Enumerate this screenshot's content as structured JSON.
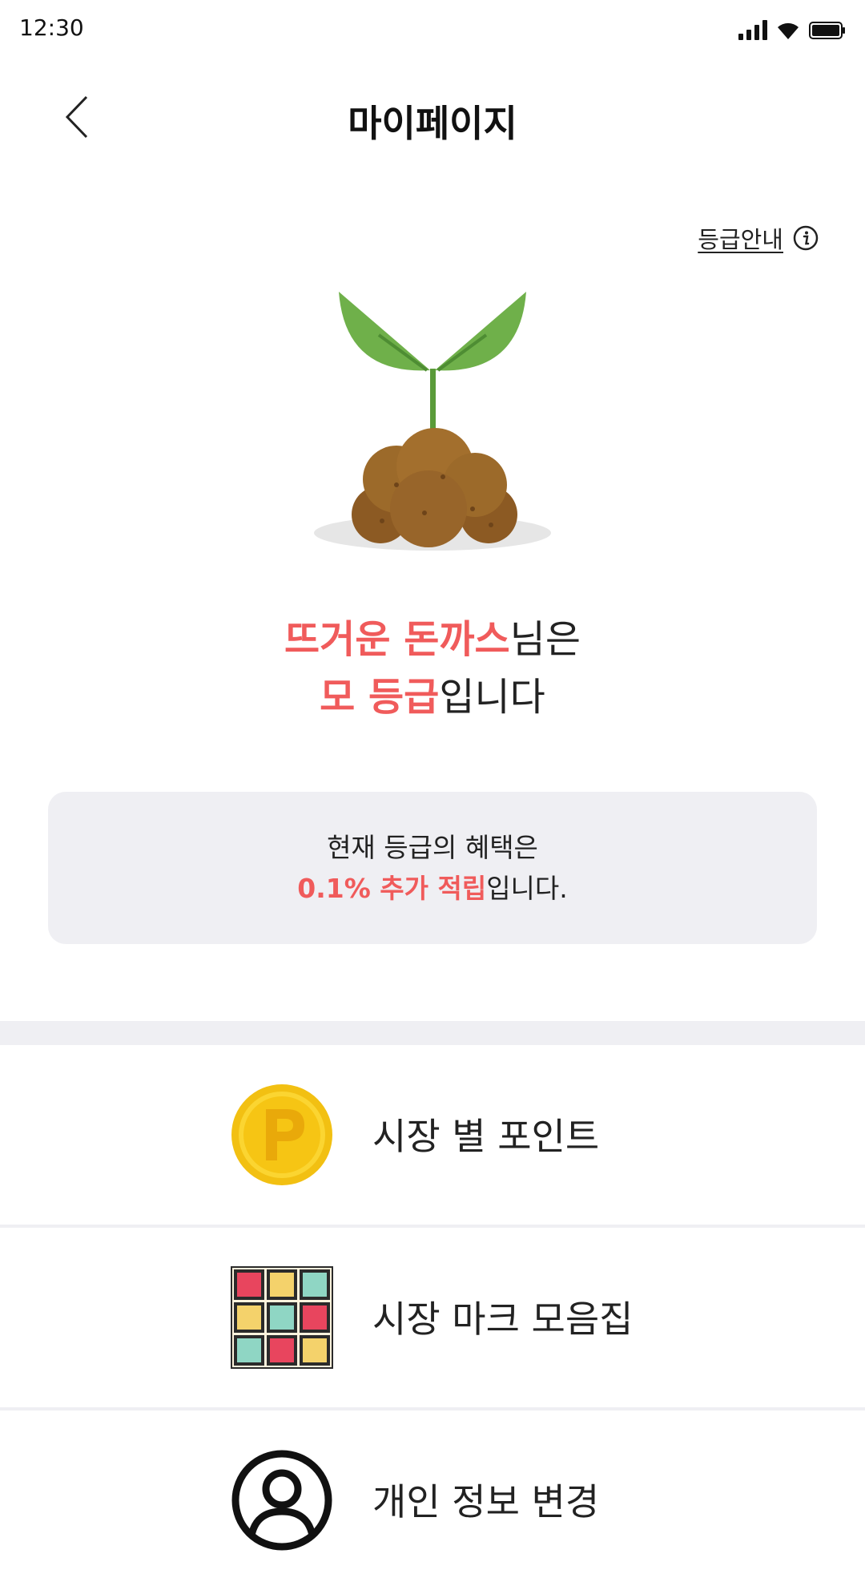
{
  "status_bar": {
    "time": "12:30",
    "icons": [
      "signal-icon",
      "wifi-icon",
      "battery-icon"
    ]
  },
  "header": {
    "back_icon": "chevron-left-icon",
    "title": "마이페이지"
  },
  "grade_guide": {
    "label": "등급안내",
    "icon": "info-icon"
  },
  "grade_image_icon": "sprout-icon",
  "greeting": {
    "nickname": "뜨거운 돈까스",
    "suffix1": "님은",
    "grade": "모 등급",
    "suffix2": "입니다"
  },
  "benefit": {
    "line1": "현재 등급의 혜택은",
    "highlight": "0.1% 추가 적립",
    "suffix": "입니다."
  },
  "menu": [
    {
      "label": "시장 별 포인트",
      "icon": "point-coin-icon"
    },
    {
      "label": "시장 마크 모음집",
      "icon": "mark-collection-grid-icon"
    },
    {
      "label": "개인 정보 변경",
      "icon": "user-profile-icon"
    }
  ],
  "colors": {
    "accent": "#f05b5b",
    "panel_bg": "#efeff3",
    "text": "#222222"
  }
}
